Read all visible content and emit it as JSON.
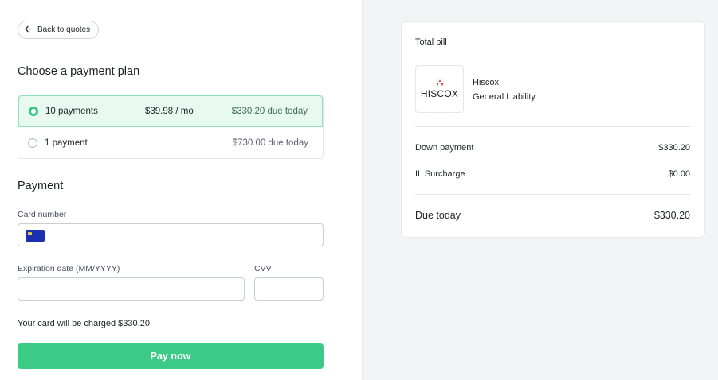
{
  "nav": {
    "back_label": "Back to quotes"
  },
  "plan_section": {
    "title": "Choose a payment plan",
    "plans": [
      {
        "label": "10 payments",
        "monthly": "$39.98 / mo",
        "due": "$330.20 due today",
        "selected": true
      },
      {
        "label": "1 payment",
        "monthly": "",
        "due": "$730.00 due today",
        "selected": false
      }
    ]
  },
  "payment_section": {
    "title": "Payment",
    "card_number_label": "Card number",
    "card_number_value": "",
    "expiration_label": "Expiration date (MM/YYYY)",
    "expiration_value": "",
    "cvv_label": "CVV",
    "cvv_value": "",
    "charge_note_prefix": "Your card will be charged ",
    "charge_note_amount": "$330.20",
    "charge_note_suffix": ".",
    "pay_button_label": "Pay now"
  },
  "summary": {
    "title": "Total bill",
    "carrier_logo_text": "HISCOX",
    "carrier_name": "Hiscox",
    "product": "General Liability",
    "lines": [
      {
        "label": "Down payment",
        "value": "$330.20"
      },
      {
        "label": "IL Surcharge",
        "value": "$0.00"
      }
    ],
    "total_label": "Due today",
    "total_value": "$330.20"
  },
  "colors": {
    "accent_green": "#3ccb86",
    "selected_plan_bg": "#e8f9f0",
    "right_panel_bg": "#f3f4f6",
    "card_icon_blue": "#1b2fb0",
    "logo_red": "#d6242b"
  },
  "icons": {
    "back": "arrow-left-icon",
    "card": "credit-card-icon",
    "logo_mark": "hiscox-mark-icon"
  }
}
